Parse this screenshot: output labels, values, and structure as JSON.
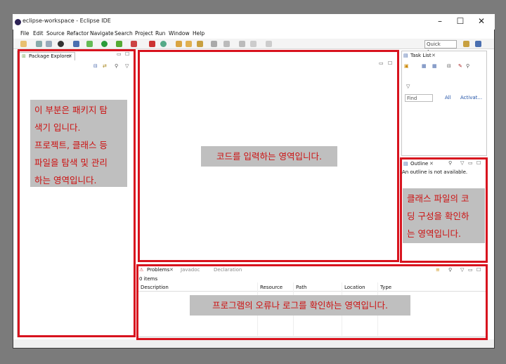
{
  "window": {
    "title": "eclipse-workspace - Eclipse IDE",
    "minimize": "–",
    "maximize": "☐",
    "close": "✕"
  },
  "menu": [
    "File",
    "Edit",
    "Source",
    "Refactor",
    "Navigate",
    "Search",
    "Project",
    "Run",
    "Window",
    "Help"
  ],
  "toolbar": {
    "quick_access": "Quick Access"
  },
  "package_explorer": {
    "title": "Package Explorer"
  },
  "task_list": {
    "title": "Task List",
    "find": "Find",
    "all": "All",
    "activate": "Activat..."
  },
  "outline": {
    "title": "Outline",
    "message": "An outline is not available."
  },
  "bottom": {
    "tabs": [
      "Problems",
      "Javadoc",
      "Declaration"
    ],
    "items": "0 items",
    "columns": [
      "Description",
      "Resource",
      "Path",
      "Location",
      "Type"
    ]
  },
  "notes": {
    "package_explorer": "이 부분은 패키지 탐\n색기 입니다.\n프로젝트, 클래스 등\n파일을 탐색 및 관리\n하는 영역입니다.",
    "editor": "코드를 입력하는 영역입니다.",
    "outline": "클래스 파일의 코\n딩 구성을 확인하\n는 영역입니다.",
    "problems": "프로그램의 오류나 로그를 확인하는 영역입니다."
  },
  "colors": {
    "highlight": "#d8131e",
    "note_bg": "#bfbfbf",
    "note_text": "#cc1111"
  }
}
